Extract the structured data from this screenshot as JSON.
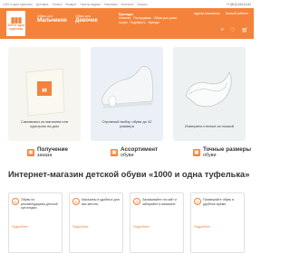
{
  "topbar": {
    "links": [
      "1000 и одна туфелька",
      "Доставка",
      "Оплата",
      "Возврат",
      "Пункты выдачи",
      "Магазины",
      "Контакты",
      "Бонусы"
    ],
    "phone": "+7 (812) 244-10-61"
  },
  "header": {
    "brand_lines": [
      "1000 и одна",
      "туфелька"
    ],
    "boys": {
      "small": "Обувь для",
      "big": "Мальчиков"
    },
    "girls": {
      "small": "Обувь для",
      "big": "Девочек"
    },
    "center_title": "Бренды",
    "center_menu": [
      "Новинки",
      "Распродажа",
      "Обувь для дома"
    ],
    "center_menu2": [
      "Акции",
      "Подобрать",
      "Бренды"
    ],
    "right": [
      "Адреса магазинов",
      "Личный кабинет"
    ],
    "icons": [
      "search-icon",
      "heart-icon",
      "cart-icon"
    ]
  },
  "hero": [
    {
      "caption": "Самовывоз из магазина или курьером на дом"
    },
    {
      "caption": "Огромный выбор обуви до 42 размера"
    },
    {
      "caption": "Измеряем стельки за ножкой"
    }
  ],
  "features": [
    {
      "title": "Получение",
      "sub": "заказа"
    },
    {
      "title": "Ассортимент",
      "sub": "обуви"
    },
    {
      "title": "Точные размеры",
      "sub": "обуви"
    }
  ],
  "heading": "Интернет-магазин детской обуви «1000 и одна туфелька»",
  "info": [
    {
      "text": "Обувь по рекомендациям детской ортопедии",
      "more": "Подробнее"
    },
    {
      "text": "Магазины в удобных для вас местах",
      "more": "Подробнее"
    },
    {
      "text": "Заказывайте на сайт и забирайте в магазине",
      "more": "Подробнее"
    },
    {
      "text": "Примеряйте обувь в удобное время",
      "more": "Подробнее"
    }
  ]
}
